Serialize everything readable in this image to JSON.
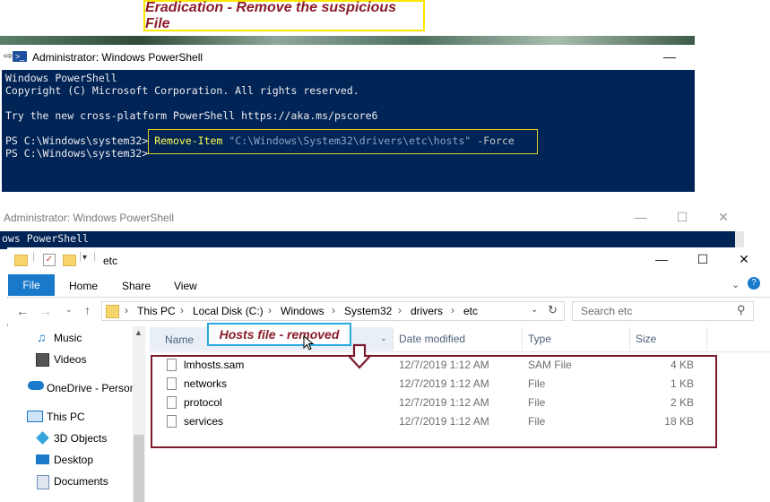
{
  "caption": {
    "text": "Eradication - Remove the suspicious File"
  },
  "powershell_top": {
    "title": "Administrator: Windows PowerShell",
    "minimize": "—",
    "lines": [
      "Windows PowerShell",
      "Copyright (C) Microsoft Corporation. All rights reserved.",
      "",
      "Try the new cross-platform PowerShell https://aka.ms/pscore6",
      ""
    ],
    "prompt": "PS C:\\Windows\\system32>",
    "cmdlet": "Remove-Item",
    "path_arg": "\"C:\\Windows\\System32\\drivers\\etc\\hosts\"",
    "param": "-Force",
    "prompt2": "PS C:\\Windows\\system32>"
  },
  "powershell_back": {
    "title": "Administrator: Windows PowerShell",
    "minimize": "—",
    "maximize": "☐",
    "close": "✕",
    "console_text": "ows PowerShell"
  },
  "explorer": {
    "title": "etc",
    "window_buttons": {
      "minimize": "—",
      "maximize": "☐",
      "close": "✕"
    },
    "ribbon_tabs": [
      "File",
      "Home",
      "Share",
      "View"
    ],
    "breadcrumb": [
      "This PC",
      "Local Disk (C:)",
      "Windows",
      "System32",
      "drivers",
      "etc"
    ],
    "search_placeholder": "Search etc",
    "columns": {
      "name": "Name",
      "date": "Date modified",
      "type": "Type",
      "size": "Size"
    },
    "rows": [
      {
        "name": "lmhosts.sam",
        "date": "12/7/2019 1:12 AM",
        "type": "SAM File",
        "size": "4 KB"
      },
      {
        "name": "networks",
        "date": "12/7/2019 1:12 AM",
        "type": "File",
        "size": "1 KB"
      },
      {
        "name": "protocol",
        "date": "12/7/2019 1:12 AM",
        "type": "File",
        "size": "2 KB"
      },
      {
        "name": "services",
        "date": "12/7/2019 1:12 AM",
        "type": "File",
        "size": "18 KB"
      }
    ],
    "nav": [
      "Music",
      "Videos",
      "OneDrive - Person",
      "This PC",
      "3D Objects",
      "Desktop",
      "Documents"
    ],
    "overlay_label": "Hosts file - removed"
  },
  "colors": {
    "console_bg": "#012456",
    "accent_blue": "#1979ca",
    "annotation_red": "#7b1a2e",
    "highlight_yellow": "#e4d11a"
  }
}
